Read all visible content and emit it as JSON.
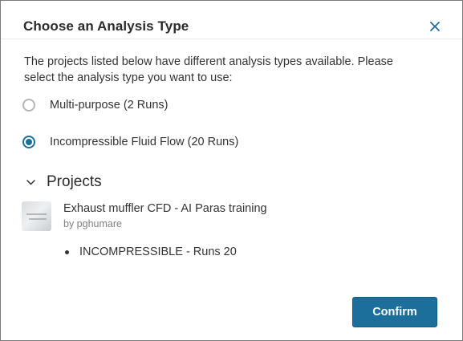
{
  "dialog": {
    "title": "Choose an Analysis Type",
    "close_icon": "close-icon",
    "description": "The projects listed below have different analysis types available. Please select the analysis type you want to use:",
    "options": [
      {
        "label": "Multi-purpose (2 Runs)",
        "selected": false
      },
      {
        "label": "Incompressible Fluid Flow (20 Runs)",
        "selected": true
      }
    ],
    "projects_section": {
      "title": "Projects",
      "toggle_icon": "chevron-down-icon",
      "items": [
        {
          "name": "Exhaust muffler CFD - AI Paras training",
          "owner": "by pghumare",
          "thumbnail_icon": "project-thumbnail",
          "runs": [
            "INCOMPRESSIBLE - Runs 20"
          ]
        }
      ]
    },
    "confirm_label": "Confirm"
  },
  "colors": {
    "accent": "#1d6f9b",
    "text": "#333333",
    "muted": "#808080",
    "border": "#7a7a7a"
  }
}
